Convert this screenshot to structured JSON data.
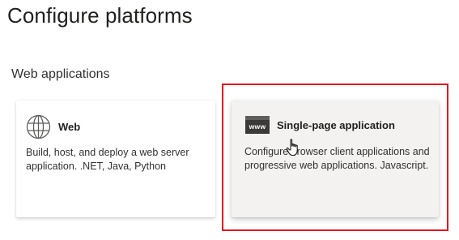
{
  "page": {
    "title": "Configure platforms"
  },
  "section": {
    "title": "Web applications"
  },
  "cards": [
    {
      "name": "Web",
      "icon": "globe-icon",
      "description": "Build, host, and deploy a web server application. .NET, Java, Python"
    },
    {
      "name": "Single-page application",
      "icon": "www-icon",
      "icon_text": "www",
      "description": "Configure browser client applications and progressive web applications. Javascript."
    }
  ],
  "colors": {
    "highlight": "#e8111b",
    "selected_card_bg": "#f3f2f1"
  }
}
